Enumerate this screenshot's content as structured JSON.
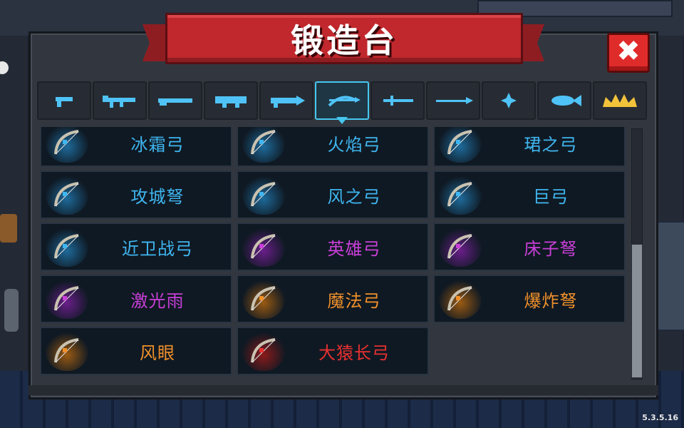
{
  "title": "锻造台",
  "close_label": "✖",
  "version": "5.3.5.16",
  "tabs": [
    {
      "icon": "pistol-icon"
    },
    {
      "icon": "rifle-icon"
    },
    {
      "icon": "shotgun-icon"
    },
    {
      "icon": "launcher-icon"
    },
    {
      "icon": "laser-gun-icon"
    },
    {
      "icon": "bow-icon",
      "active": true
    },
    {
      "icon": "sword-icon"
    },
    {
      "icon": "spear-icon"
    },
    {
      "icon": "shuriken-icon"
    },
    {
      "icon": "fish-icon"
    },
    {
      "icon": "crown-icon"
    }
  ],
  "items": [
    {
      "name": "冰霜弓",
      "color": "#3fb6f0",
      "glow": "#1e6a9a"
    },
    {
      "name": "火焰弓",
      "color": "#3fb6f0",
      "glow": "#1e6a9a"
    },
    {
      "name": "珺之弓",
      "color": "#3fb6f0",
      "glow": "#1e6a9a"
    },
    {
      "name": "攻城弩",
      "color": "#3fb6f0",
      "glow": "#1e6a9a"
    },
    {
      "name": "风之弓",
      "color": "#3fb6f0",
      "glow": "#1e6a9a"
    },
    {
      "name": "巨弓",
      "color": "#3fb6f0",
      "glow": "#1e6a9a"
    },
    {
      "name": "近卫战弓",
      "color": "#3fb6f0",
      "glow": "#1e6a9a"
    },
    {
      "name": "英雄弓",
      "color": "#c93fd8",
      "glow": "#6a1e8a"
    },
    {
      "name": "床子弩",
      "color": "#c93fd8",
      "glow": "#6a1e8a"
    },
    {
      "name": "激光雨",
      "color": "#c93fd8",
      "glow": "#6a1e8a"
    },
    {
      "name": "魔法弓",
      "color": "#f0902a",
      "glow": "#9a5a12"
    },
    {
      "name": "爆炸弩",
      "color": "#f0902a",
      "glow": "#9a5a12"
    },
    {
      "name": "风眼",
      "color": "#f0902a",
      "glow": "#9a5a12"
    },
    {
      "name": "大猿长弓",
      "color": "#e83030",
      "glow": "#8a1a1a"
    }
  ]
}
